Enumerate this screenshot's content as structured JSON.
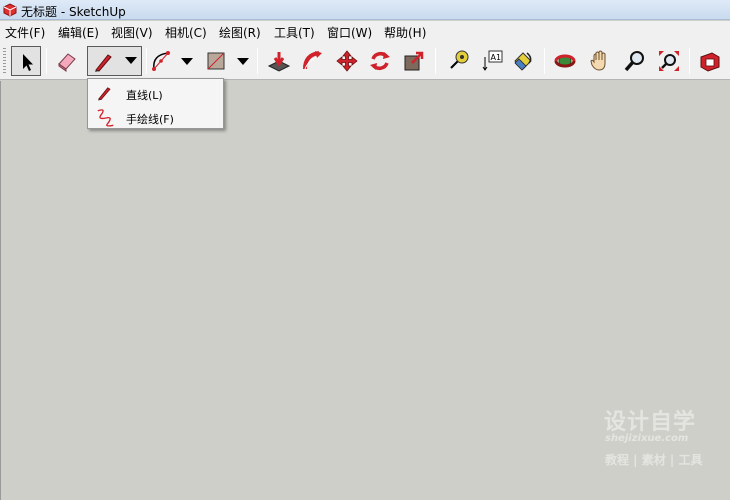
{
  "window": {
    "title": "无标题 - SketchUp",
    "app_icon": "sketchup-icon"
  },
  "menu": [
    {
      "label": "文件(F)"
    },
    {
      "label": "编辑(E)"
    },
    {
      "label": "视图(V)"
    },
    {
      "label": "相机(C)"
    },
    {
      "label": "绘图(R)"
    },
    {
      "label": "工具(T)"
    },
    {
      "label": "窗口(W)"
    },
    {
      "label": "帮助(H)"
    }
  ],
  "toolbar": {
    "tools": [
      {
        "icon": "select-arrow-icon",
        "state": "pressed"
      },
      {
        "icon": "eraser-icon"
      },
      {
        "icon": "pencil-line-icon",
        "state": "pressed",
        "has_dropdown": true
      },
      {
        "icon": "arc-icon",
        "has_dropdown": true
      },
      {
        "icon": "rectangle-icon",
        "has_dropdown": true
      },
      {
        "icon": "push-pull-icon"
      },
      {
        "icon": "follow-me-icon"
      },
      {
        "icon": "move-icon"
      },
      {
        "icon": "rotate-icon"
      },
      {
        "icon": "scale-icon"
      },
      {
        "icon": "tape-measure-icon"
      },
      {
        "icon": "text-label-icon",
        "text": "A1"
      },
      {
        "icon": "paint-bucket-icon"
      },
      {
        "icon": "orbit-icon"
      },
      {
        "icon": "pan-hand-icon"
      },
      {
        "icon": "zoom-icon"
      },
      {
        "icon": "zoom-extents-icon"
      },
      {
        "icon": "warehouse-icon"
      }
    ]
  },
  "line_dropdown": {
    "items": [
      {
        "label": "直线(L)",
        "icon": "pencil-line-icon"
      },
      {
        "label": "手绘线(F)",
        "icon": "freehand-icon"
      }
    ]
  },
  "watermark": {
    "title": "设计自学",
    "url": "shejizixue.com",
    "subtitle": "教程 | 素材 | 工具"
  },
  "colors": {
    "canvas": "#cfcfca",
    "accent_red": "#d0222a",
    "toolbar": "#f0f0f0"
  }
}
